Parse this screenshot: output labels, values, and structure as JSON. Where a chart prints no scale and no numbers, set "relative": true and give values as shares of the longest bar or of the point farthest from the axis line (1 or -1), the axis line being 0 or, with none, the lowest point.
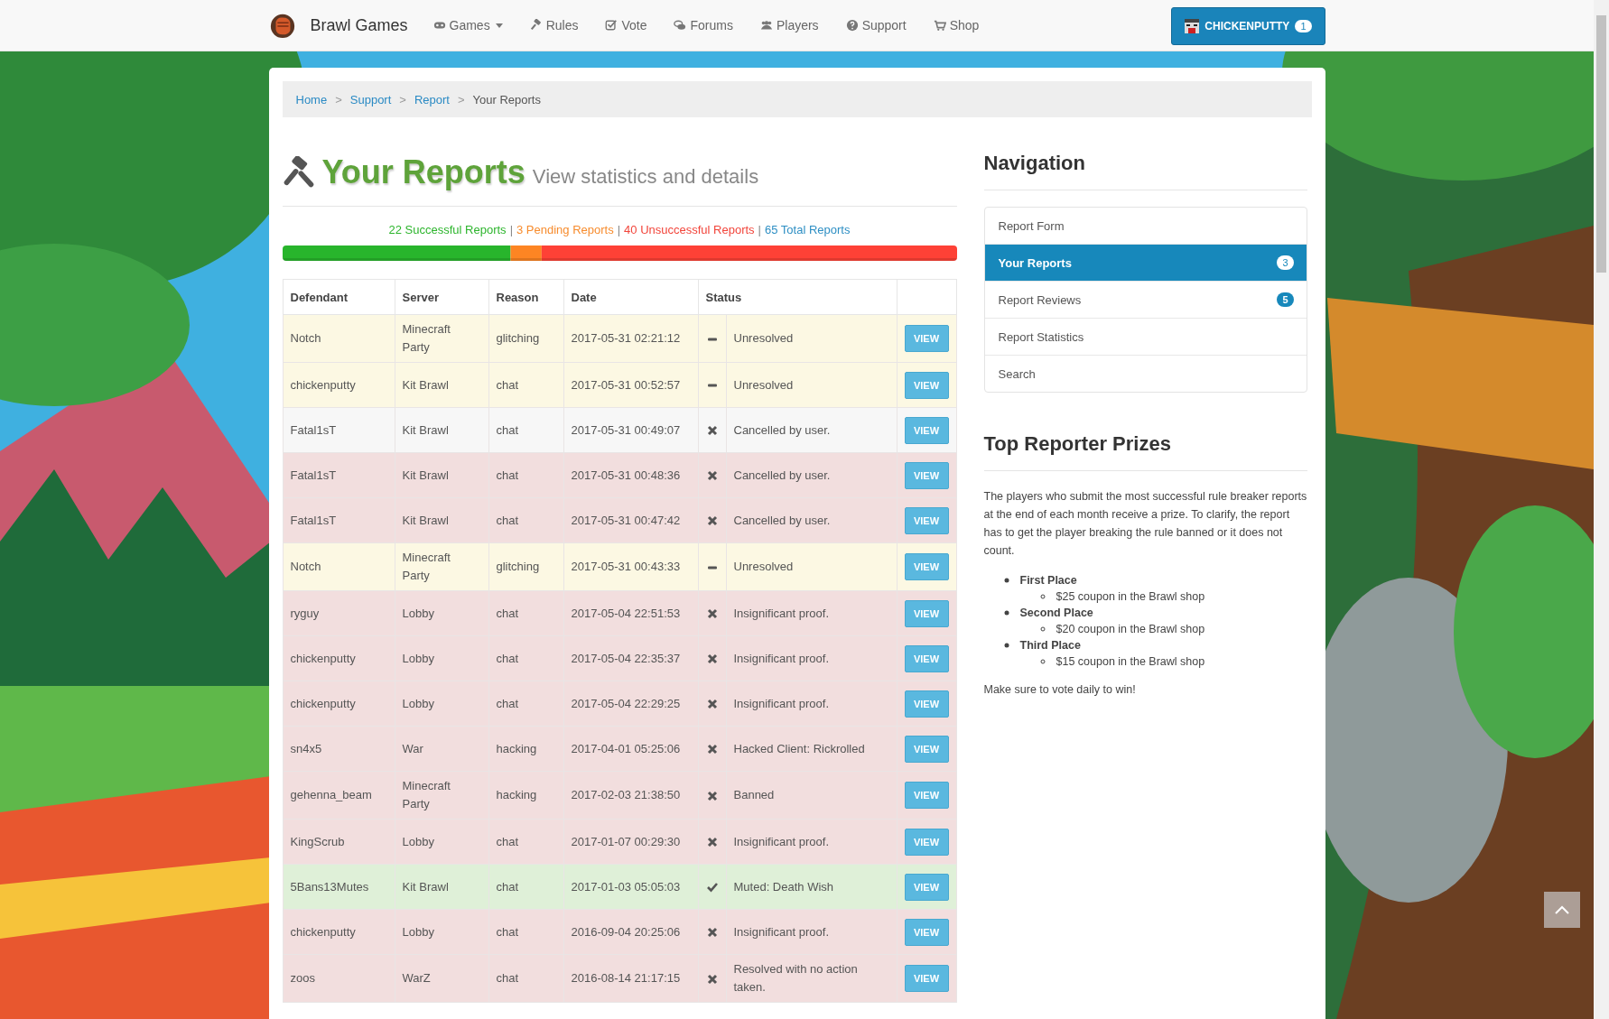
{
  "navbar": {
    "brand": "Brawl Games",
    "items": [
      {
        "label": "Games",
        "dropdown": true
      },
      {
        "label": "Rules",
        "dropdown": false
      },
      {
        "label": "Vote",
        "dropdown": false
      },
      {
        "label": "Forums",
        "dropdown": false
      },
      {
        "label": "Players",
        "dropdown": false
      },
      {
        "label": "Support",
        "dropdown": false
      },
      {
        "label": "Shop",
        "dropdown": false
      }
    ],
    "user": {
      "name": "CHICKENPUTTY",
      "badge": "1"
    }
  },
  "breadcrumb": [
    {
      "label": "Home",
      "current": false
    },
    {
      "sep": ">",
      "label": "Support",
      "current": false
    },
    {
      "sep": ">",
      "label": "Report",
      "current": false
    },
    {
      "sep": ">",
      "label": "Your Reports",
      "current": true
    }
  ],
  "header": {
    "title": "Your Reports",
    "subtitle": "View statistics and details"
  },
  "summary": [
    {
      "text": "22 Successful Reports",
      "color": "#2db52d"
    },
    {
      "sep": "|",
      "text": "3 Pending Reports",
      "color": "#f78c2e"
    },
    {
      "sep": "|",
      "text": "40 Unsuccessful Reports",
      "color": "#f2453b"
    },
    {
      "sep": "|",
      "text": "65 Total Reports",
      "color": "#2e8fc4"
    }
  ],
  "progress": {
    "chart_data": {
      "type": "bar",
      "orientation": "horizontal",
      "stacked": true,
      "relative": true,
      "series": [
        {
          "color": "#28b52c",
          "values": [
            0.338
          ]
        },
        {
          "color": "#fd8523",
          "values": [
            0.046
          ]
        },
        {
          "color": "#fe4136",
          "values": [
            0.616
          ]
        }
      ]
    }
  },
  "table": {
    "columns": [
      "Defendant",
      "Server",
      "Reason",
      "Date",
      "Status"
    ],
    "rows": [
      {
        "defendant": "Notch",
        "server": "Minecraft Party",
        "reason": "glitching",
        "date": "2017-05-31 02:21:12",
        "status": "Unresolved",
        "kind": "pending",
        "highlighted": false,
        "button": "VIEW"
      },
      {
        "defendant": "chickenputty",
        "server": "Kit Brawl",
        "reason": "chat",
        "date": "2017-05-31 00:52:57",
        "status": "Unresolved",
        "kind": "pending",
        "highlighted": false,
        "button": "VIEW"
      },
      {
        "defendant": "Fatal1sT",
        "server": "Kit Brawl",
        "reason": "chat",
        "date": "2017-05-31 00:49:07",
        "status": "Cancelled by user.",
        "kind": "failed",
        "highlighted": true,
        "button": "VIEW"
      },
      {
        "defendant": "Fatal1sT",
        "server": "Kit Brawl",
        "reason": "chat",
        "date": "2017-05-31 00:48:36",
        "status": "Cancelled by user.",
        "kind": "failed",
        "highlighted": false,
        "button": "VIEW"
      },
      {
        "defendant": "Fatal1sT",
        "server": "Kit Brawl",
        "reason": "chat",
        "date": "2017-05-31 00:47:42",
        "status": "Cancelled by user.",
        "kind": "failed",
        "highlighted": false,
        "button": "VIEW"
      },
      {
        "defendant": "Notch",
        "server": "Minecraft Party",
        "reason": "glitching",
        "date": "2017-05-31 00:43:33",
        "status": "Unresolved",
        "kind": "pending",
        "highlighted": false,
        "button": "VIEW"
      },
      {
        "defendant": "ryguy",
        "server": "Lobby",
        "reason": "chat",
        "date": "2017-05-04 22:51:53",
        "status": "Insignificant proof.",
        "kind": "failed",
        "highlighted": false,
        "button": "VIEW"
      },
      {
        "defendant": "chickenputty",
        "server": "Lobby",
        "reason": "chat",
        "date": "2017-05-04 22:35:37",
        "status": "Insignificant proof.",
        "kind": "failed",
        "highlighted": false,
        "button": "VIEW"
      },
      {
        "defendant": "chickenputty",
        "server": "Lobby",
        "reason": "chat",
        "date": "2017-05-04 22:29:25",
        "status": "Insignificant proof.",
        "kind": "failed",
        "highlighted": false,
        "button": "VIEW"
      },
      {
        "defendant": "sn4x5",
        "server": "War",
        "reason": "hacking",
        "date": "2017-04-01 05:25:06",
        "status": "Hacked Client: Rickrolled",
        "kind": "failed",
        "highlighted": false,
        "button": "VIEW"
      },
      {
        "defendant": "gehenna_beam",
        "server": "Minecraft Party",
        "reason": "hacking",
        "date": "2017-02-03 21:38:50",
        "status": "Banned",
        "kind": "failed",
        "highlighted": false,
        "button": "VIEW"
      },
      {
        "defendant": "KingScrub",
        "server": "Lobby",
        "reason": "chat",
        "date": "2017-01-07 00:29:30",
        "status": "Insignificant proof.",
        "kind": "failed",
        "highlighted": false,
        "button": "VIEW"
      },
      {
        "defendant": "5Bans13Mutes",
        "server": "Kit Brawl",
        "reason": "chat",
        "date": "2017-01-03 05:05:03",
        "status": "Muted: Death Wish",
        "kind": "success",
        "highlighted": false,
        "button": "VIEW"
      },
      {
        "defendant": "chickenputty",
        "server": "Lobby",
        "reason": "chat",
        "date": "2016-09-04 20:25:06",
        "status": "Insignificant proof.",
        "kind": "failed",
        "highlighted": false,
        "button": "VIEW"
      },
      {
        "defendant": "zoos",
        "server": "WarZ",
        "reason": "chat",
        "date": "2016-08-14 21:17:15",
        "status": "Resolved with no action taken.",
        "kind": "failed",
        "highlighted": false,
        "button": "VIEW"
      }
    ]
  },
  "navigation": {
    "title": "Navigation",
    "items": [
      {
        "label": "Report Form",
        "selected": false
      },
      {
        "label": "Your Reports",
        "selected": true,
        "badge": "3"
      },
      {
        "label": "Report Reviews",
        "selected": false,
        "badge": "5"
      },
      {
        "label": "Report Statistics",
        "selected": false
      },
      {
        "label": "Search",
        "selected": false
      }
    ]
  },
  "prizes": {
    "title": "Top Reporter Prizes",
    "intro": "The players who submit the most successful rule breaker reports at the end of each month receive a prize. To clarify, the report has to get the player breaking the rule banned or it does not count.",
    "places": [
      {
        "place": "First Place",
        "prize": "$25 coupon in the Brawl shop"
      },
      {
        "place": "Second Place",
        "prize": "$20 coupon in the Brawl shop"
      },
      {
        "place": "Third Place",
        "prize": "$15 coupon in the Brawl shop"
      }
    ],
    "footer": "Make sure to vote daily to win!"
  }
}
